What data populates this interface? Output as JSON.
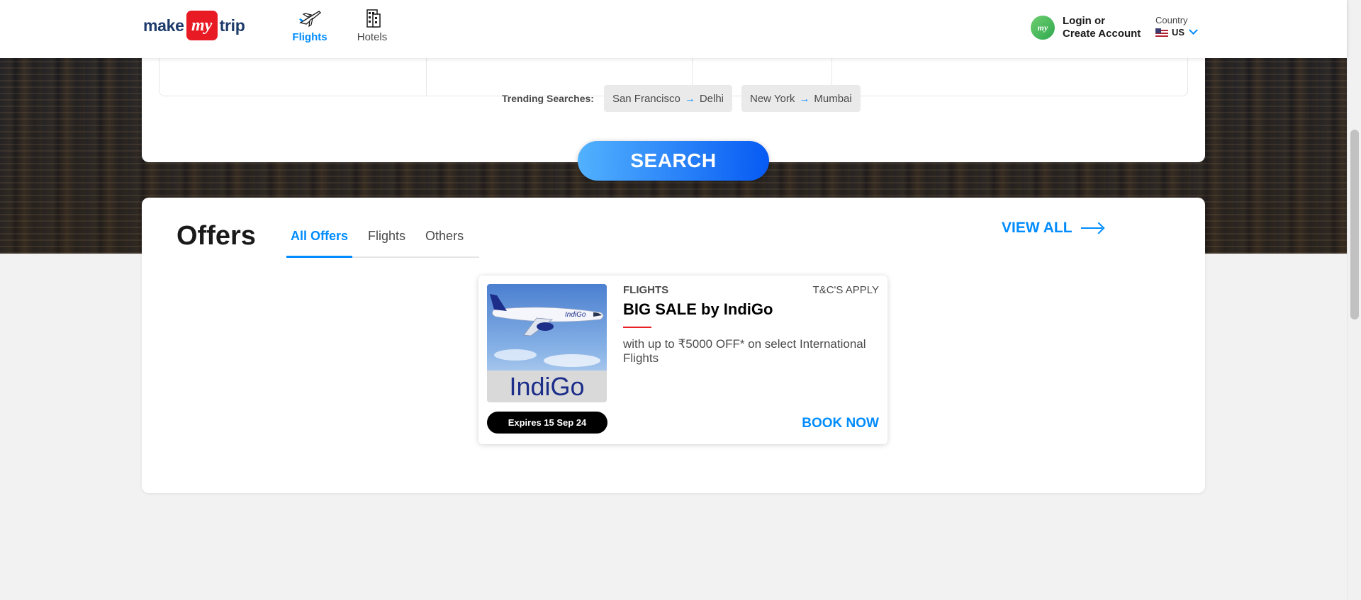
{
  "header": {
    "logo": {
      "make": "make",
      "my": "my",
      "trip": "trip"
    },
    "nav": [
      {
        "label": "Flights",
        "icon": "plane-icon",
        "active": true
      },
      {
        "label": "Hotels",
        "icon": "hotel-building-icon",
        "active": false
      }
    ],
    "login": {
      "avatar": "my",
      "line1": "Login or",
      "line2": "Create Account"
    },
    "country": {
      "label": "Country",
      "value": "US",
      "flag": "us-flag-icon"
    }
  },
  "search": {
    "trending_label": "Trending Searches:",
    "trending": [
      {
        "from": "San Francisco",
        "to": "Delhi"
      },
      {
        "from": "New York",
        "to": "Mumbai"
      }
    ],
    "button_label": "SEARCH"
  },
  "offers": {
    "title": "Offers",
    "tabs": [
      {
        "label": "All Offers",
        "active": true
      },
      {
        "label": "Flights",
        "active": false
      },
      {
        "label": "Others",
        "active": false
      }
    ],
    "view_all": "VIEW ALL",
    "cards": [
      {
        "category": "FLIGHTS",
        "tnc": "T&C'S APPLY",
        "title": "BIG SALE by IndiGo",
        "description": "with up to ₹5000 OFF* on select International Flights",
        "image_brand": "IndiGo",
        "expires": "Expires 15 Sep 24",
        "cta": "BOOK NOW"
      }
    ]
  },
  "colors": {
    "accent": "#008cff",
    "brand_red": "#e81b25",
    "search_gradient_start": "#53b2fe",
    "search_gradient_end": "#065af3"
  }
}
